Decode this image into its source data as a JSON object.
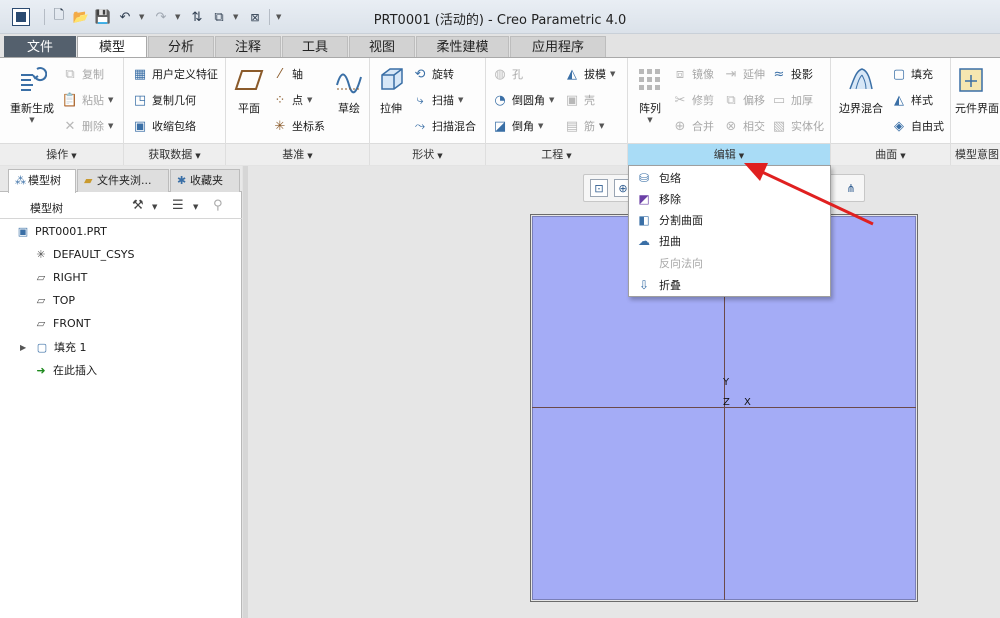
{
  "window": {
    "title": "PRT0001 (活动的) - Creo Parametric 4.0"
  },
  "tabs": [
    {
      "label": "文件"
    },
    {
      "label": "模型"
    },
    {
      "label": "分析"
    },
    {
      "label": "注释"
    },
    {
      "label": "工具"
    },
    {
      "label": "视图"
    },
    {
      "label": "柔性建模"
    },
    {
      "label": "应用程序"
    }
  ],
  "ribbon": {
    "groups": {
      "operations": {
        "label": "操作",
        "regenerate": "重新生成",
        "copy": "复制",
        "paste": "粘贴",
        "delete": "删除"
      },
      "get_data": {
        "label": "获取数据",
        "udf": "用户定义特征",
        "copy_geom": "复制几何",
        "shrinkwrap": "收缩包络"
      },
      "datum": {
        "label": "基准",
        "plane": "平面",
        "axis": "轴",
        "point": "点",
        "csys": "坐标系",
        "sketch": "草绘"
      },
      "shapes": {
        "label": "形状",
        "extrude": "拉伸",
        "revolve": "旋转",
        "sweep": "扫描",
        "swept_blend": "扫描混合"
      },
      "engineering": {
        "label": "工程",
        "hole": "孔",
        "draft": "拔模",
        "round": "倒圆角",
        "shell": "壳",
        "chamfer": "倒角",
        "rib": "筋"
      },
      "editing": {
        "label": "编辑",
        "pattern": "阵列",
        "mirror": "镜像",
        "extend": "延伸",
        "project": "投影",
        "trim": "修剪",
        "offset": "偏移",
        "thicken": "加厚",
        "merge": "合并",
        "intersect": "相交",
        "solidify": "实体化"
      },
      "surfaces": {
        "label": "曲面",
        "boundary_blend": "边界混合",
        "fill": "填充",
        "style": "样式",
        "freestyle": "自由式"
      },
      "model_intent": {
        "label": "模型意图",
        "component_interface": "元件界面"
      }
    }
  },
  "model_tree": {
    "tabs": [
      {
        "label": "模型树"
      },
      {
        "label": "文件夹浏..."
      },
      {
        "label": "收藏夹"
      }
    ],
    "title": "模型树",
    "nodes": [
      {
        "label": "PRT0001.PRT"
      },
      {
        "label": "DEFAULT_CSYS"
      },
      {
        "label": "RIGHT"
      },
      {
        "label": "TOP"
      },
      {
        "label": "FRONT"
      },
      {
        "label": "填充 1"
      },
      {
        "label": "在此插入"
      }
    ]
  },
  "editing_menu": {
    "items": [
      {
        "label": "包络",
        "enabled": true
      },
      {
        "label": "移除",
        "enabled": true
      },
      {
        "label": "分割曲面",
        "enabled": true
      },
      {
        "label": "扭曲",
        "enabled": true
      },
      {
        "label": "反向法向",
        "enabled": false
      },
      {
        "label": "折叠",
        "enabled": true
      }
    ]
  },
  "graphics": {
    "axis_labels": {
      "y": "Y",
      "z": "Z",
      "x": "X"
    }
  },
  "colors": {
    "plane_fill": "#a4acf6",
    "highlight": "#a9dcf6",
    "annotation_arrow": "#e02020",
    "file_tab": "#54606d"
  }
}
